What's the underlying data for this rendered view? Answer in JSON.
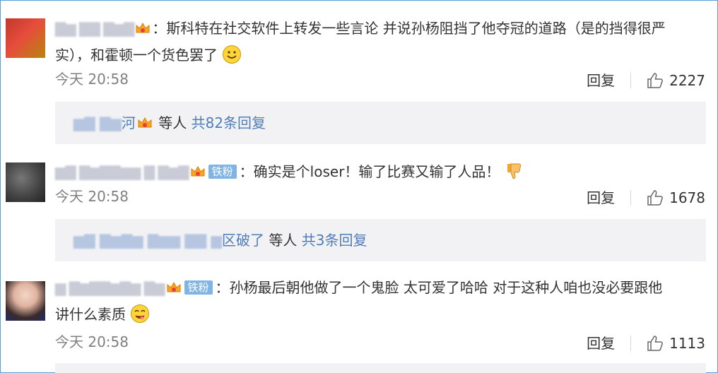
{
  "comments": [
    {
      "username": "",
      "text_line1": "：斯科特在社交软件上转发一些言论 并说孙杨阻挡了他夺冠的道路（是的挡得很严",
      "text_line2": "实），和霍顿一个货色罢了",
      "emoji": "smile-emoji",
      "time": "今天 20:58",
      "reply_label": "回复",
      "like_count": "2227",
      "sub": {
        "suffix_before": "等人",
        "link": "共82条回复",
        "user_tail": "河"
      }
    },
    {
      "username": "",
      "badge": "铁粉",
      "text_line1": "：确实是个loser！输了比赛又输了人品！",
      "emoji": "thumbs-down-emoji",
      "time": "今天 20:58",
      "reply_label": "回复",
      "like_count": "1678",
      "sub": {
        "user_tail": "区破了",
        "suffix_before": "等人",
        "link": "共3条回复"
      }
    },
    {
      "username": "",
      "badge": "铁粉",
      "text_line1": "：孙杨最后朝他做了一个鬼脸 太可爱了哈哈 对于这种人咱也没必要跟他",
      "text_line2": "讲什么素质",
      "emoji": "yum-emoji",
      "time": "今天 20:58",
      "reply_label": "回复",
      "like_count": "1113"
    }
  ],
  "colors": {
    "link": "#4f7db8",
    "badge": "#7fb4e4",
    "meta": "#808080",
    "sub_bg": "#f2f2f5",
    "frame": "#5aa0d6"
  }
}
